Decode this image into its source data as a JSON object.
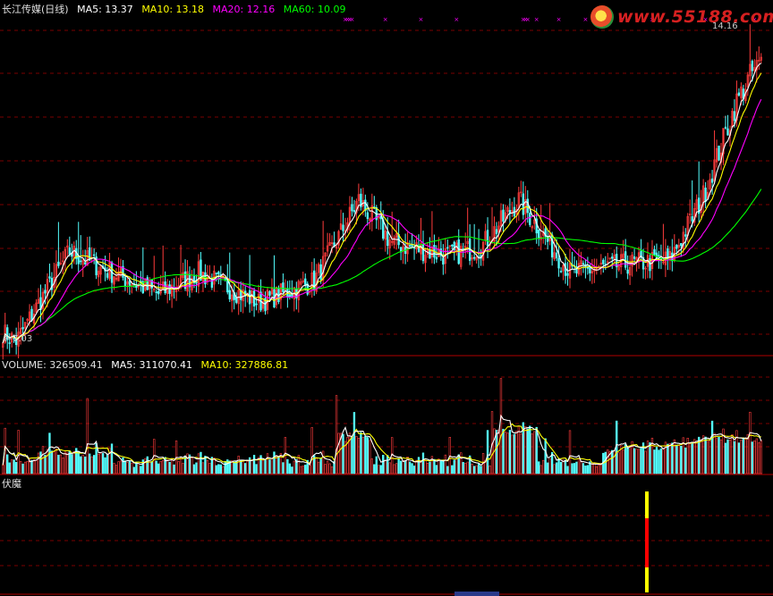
{
  "header": {
    "stock_name": "长江传媒(日线)",
    "ma5_label": "MA5: 13.37",
    "ma10_label": "MA10: 13.18",
    "ma20_label": "MA20: 12.16",
    "ma60_label": "MA60: 10.09"
  },
  "volume_header": {
    "title": "VOLUME: 326509.41",
    "ma5_label": "MA5: 311070.41",
    "ma10_label": "MA10: 327886.81"
  },
  "indicator_header": {
    "title": "伏魔"
  },
  "watermark": {
    "text": "www.55188.com",
    "logo_icon": "site-logo-icon"
  },
  "price_labels": {
    "high": "14.16",
    "low": "7.03"
  },
  "colors": {
    "background": "#000000",
    "up": "#ff3c3c",
    "down": "#54ffff",
    "ma5": "#ffffff",
    "ma10": "#ffff00",
    "ma20": "#ff00ff",
    "ma60": "#00ff00",
    "grid": "#7a0000",
    "panel_border": "#b00000",
    "signal_yellow": "#ffff00",
    "signal_red": "#ff0000"
  },
  "chart_data": {
    "type": "candlestick",
    "price_range": [
      6.8,
      14.5
    ],
    "highest_marked": 14.16,
    "lowest_marked": 7.03,
    "key_points": [
      {
        "bar": 0,
        "price": 7.3
      },
      {
        "bar": 6,
        "price": 7.1
      },
      {
        "bar": 30,
        "price": 9.2
      },
      {
        "bar": 45,
        "price": 8.8
      },
      {
        "bar": 70,
        "price": 8.2
      },
      {
        "bar": 88,
        "price": 8.7
      },
      {
        "bar": 115,
        "price": 8.0
      },
      {
        "bar": 140,
        "price": 8.5
      },
      {
        "bar": 160,
        "price": 10.4
      },
      {
        "bar": 175,
        "price": 9.4
      },
      {
        "bar": 200,
        "price": 9.1
      },
      {
        "bar": 215,
        "price": 9.3
      },
      {
        "bar": 232,
        "price": 10.4
      },
      {
        "bar": 255,
        "price": 8.7
      },
      {
        "bar": 280,
        "price": 8.9
      },
      {
        "bar": 300,
        "price": 9.0
      },
      {
        "bar": 315,
        "price": 10.5
      },
      {
        "bar": 330,
        "price": 12.7
      },
      {
        "bar": 337,
        "price": 13.4
      },
      {
        "bar": 341,
        "price": 13.6
      }
    ],
    "ma_latest": {
      "MA5": 13.37,
      "MA10": 13.18,
      "MA20": 12.16,
      "MA60": 10.09
    },
    "volume_latest": {
      "VOLUME": 326509.41,
      "MA5": 311070.41,
      "MA10": 327886.81
    },
    "signal_marks": "magenta x markers above price chart"
  }
}
